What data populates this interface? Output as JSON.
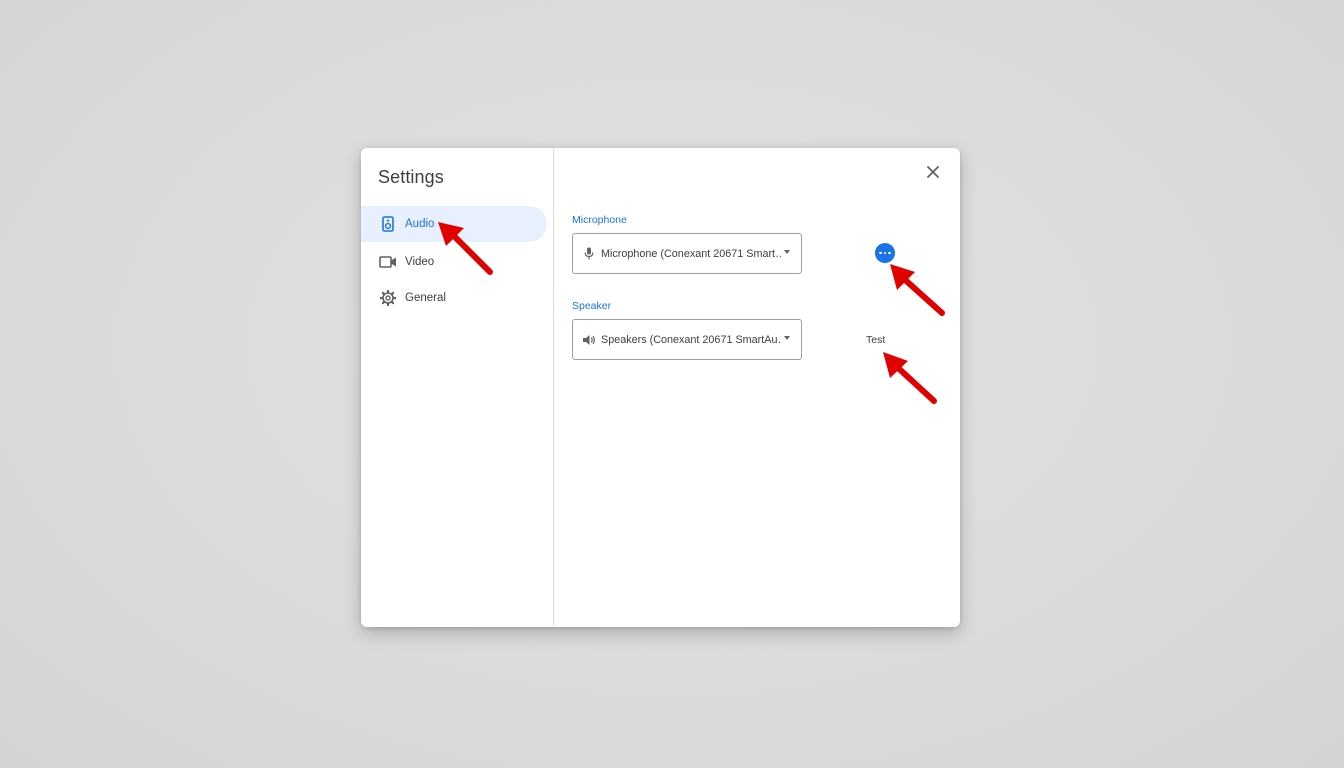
{
  "dialog": {
    "title": "Settings",
    "close_icon": "close-icon"
  },
  "sidebar": {
    "items": [
      {
        "label": "Audio",
        "icon": "speaker-device-icon",
        "active": true
      },
      {
        "label": "Video",
        "icon": "video-camera-icon",
        "active": false
      },
      {
        "label": "General",
        "icon": "gear-icon",
        "active": false
      }
    ]
  },
  "audio": {
    "microphone": {
      "label": "Microphone",
      "selected": "Microphone (Conexant 20671 Smart…",
      "icon": "microphone-icon"
    },
    "speaker": {
      "label": "Speaker",
      "selected": "Speakers (Conexant 20671 SmartAu…",
      "icon": "volume-icon",
      "test_label": "Test"
    },
    "more_options_icon": "more-horizontal-icon"
  },
  "colors": {
    "accent": "#1a73e8",
    "active_bg": "#e8f0fe",
    "annotation_arrow": "#e00000"
  }
}
